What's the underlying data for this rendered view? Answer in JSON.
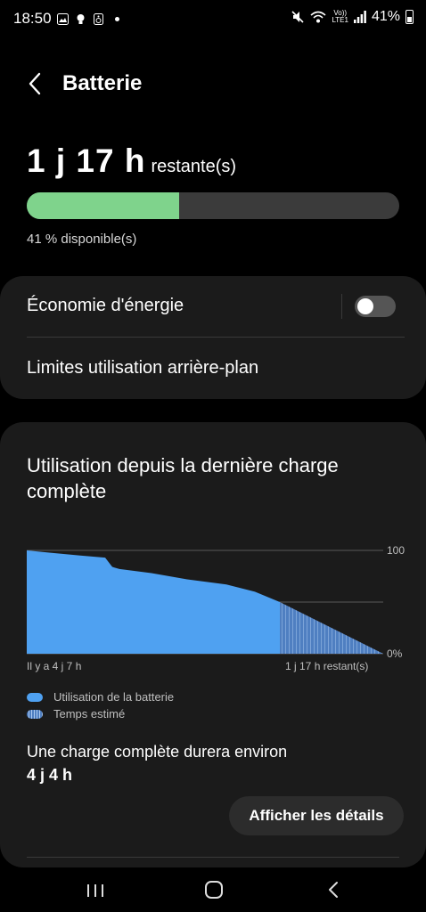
{
  "status_bar": {
    "time": "18:50",
    "left_icons": [
      "image-icon",
      "bulb-icon",
      "speaker-icon",
      "notification-dot"
    ],
    "network_top": "Vo))",
    "network_bottom": "LTE1",
    "battery_percent": "41%"
  },
  "header": {
    "title": "Batterie"
  },
  "battery": {
    "remaining_value": "1 j 17 h",
    "remaining_suffix": "restante(s)",
    "level_percent": 41,
    "available_text": "41 % disponible(s)",
    "fill_color": "#7fd38c"
  },
  "settings": {
    "power_saving_label": "Économie d'énergie",
    "power_saving_enabled": false,
    "background_limits_label": "Limites utilisation arrière-plan"
  },
  "usage": {
    "title": "Utilisation depuis la dernière charge complète",
    "y_top_label": "100",
    "y_bottom_label": "0%",
    "x_start_label": "Il y a 4 j 7 h",
    "x_end_label": "1 j 17 h restant(s)",
    "legend": [
      {
        "label": "Utilisation de la batterie",
        "color": "#4fa1f1"
      },
      {
        "label": "Temps estimé",
        "color": "#4f7fc1"
      }
    ],
    "full_charge_label": "Une charge complète durera environ",
    "full_charge_value": "4 j 4 h",
    "details_button": "Afficher les détails"
  },
  "chart_data": {
    "type": "area",
    "title": "",
    "xlabel": "",
    "ylabel": "",
    "ylim": [
      0,
      100
    ],
    "x_labels": [
      "Il y a 4 j 7 h",
      "1 j 17 h restant(s)"
    ],
    "series": [
      {
        "name": "Utilisation de la batterie",
        "x": [
          0,
          0.06,
          0.15,
          0.22,
          0.24,
          0.26,
          0.35,
          0.45,
          0.56,
          0.64,
          0.71
        ],
        "values": [
          100,
          98,
          95,
          93,
          84,
          82,
          78,
          72,
          67,
          60,
          50
        ]
      },
      {
        "name": "Temps estimé",
        "x": [
          0.71,
          1.0
        ],
        "values": [
          50,
          0
        ]
      }
    ],
    "gridlines": [
      100,
      50,
      0
    ]
  }
}
